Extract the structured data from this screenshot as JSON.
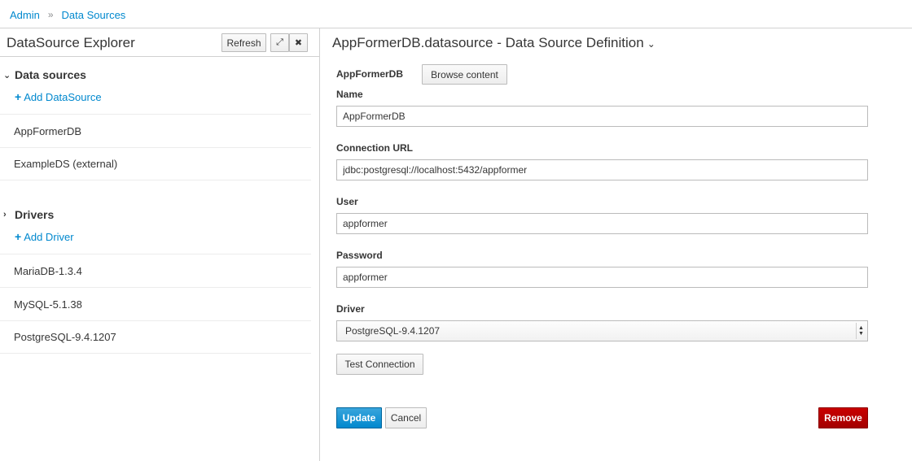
{
  "breadcrumb": {
    "items": [
      {
        "label": "Admin"
      },
      {
        "label": "Data Sources"
      }
    ],
    "separator": "»"
  },
  "explorer": {
    "title": "DataSource Explorer",
    "refresh_label": "Refresh",
    "expand_icon": "⤢",
    "close_icon": "✖",
    "datasources": {
      "title": "Data sources",
      "add_label": "Add DataSource",
      "items": [
        {
          "label": "AppFormerDB"
        },
        {
          "label": "ExampleDS (external)"
        }
      ]
    },
    "drivers": {
      "title": "Drivers",
      "add_label": "Add Driver",
      "items": [
        {
          "label": "MariaDB-1.3.4"
        },
        {
          "label": "MySQL-5.1.38"
        },
        {
          "label": "PostgreSQL-9.4.1207"
        }
      ]
    }
  },
  "definition": {
    "title": "AppFormerDB.datasource - Data Source Definition",
    "db_name": "AppFormerDB",
    "browse_label": "Browse content",
    "fields": {
      "name": {
        "label": "Name",
        "value": "AppFormerDB"
      },
      "connection_url": {
        "label": "Connection URL",
        "value": "jdbc:postgresql://localhost:5432/appformer"
      },
      "user": {
        "label": "User",
        "value": "appformer"
      },
      "password": {
        "label": "Password",
        "value": "appformer"
      },
      "driver": {
        "label": "Driver",
        "value": "PostgreSQL-9.4.1207"
      }
    },
    "test_label": "Test Connection",
    "update_label": "Update",
    "cancel_label": "Cancel",
    "remove_label": "Remove"
  },
  "colors": {
    "link": "#0088ce",
    "primary": "#0088ce",
    "danger": "#a30000",
    "border": "#d1d1d1"
  }
}
